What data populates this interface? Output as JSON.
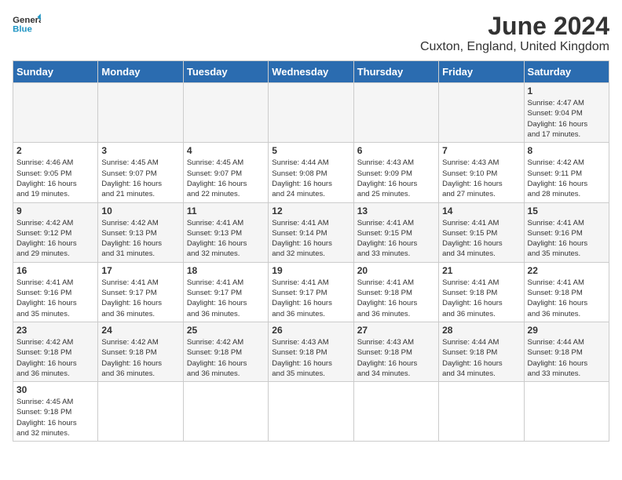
{
  "header": {
    "logo_general": "General",
    "logo_blue": "Blue",
    "title": "June 2024",
    "subtitle": "Cuxton, England, United Kingdom"
  },
  "days_of_week": [
    "Sunday",
    "Monday",
    "Tuesday",
    "Wednesday",
    "Thursday",
    "Friday",
    "Saturday"
  ],
  "weeks": [
    [
      {
        "day": "",
        "info": ""
      },
      {
        "day": "",
        "info": ""
      },
      {
        "day": "",
        "info": ""
      },
      {
        "day": "",
        "info": ""
      },
      {
        "day": "",
        "info": ""
      },
      {
        "day": "",
        "info": ""
      },
      {
        "day": "1",
        "info": "Sunrise: 4:47 AM\nSunset: 9:04 PM\nDaylight: 16 hours\nand 17 minutes."
      }
    ],
    [
      {
        "day": "2",
        "info": "Sunrise: 4:46 AM\nSunset: 9:05 PM\nDaylight: 16 hours\nand 19 minutes."
      },
      {
        "day": "3",
        "info": "Sunrise: 4:45 AM\nSunset: 9:07 PM\nDaylight: 16 hours\nand 21 minutes."
      },
      {
        "day": "4",
        "info": "Sunrise: 4:45 AM\nSunset: 9:07 PM\nDaylight: 16 hours\nand 22 minutes."
      },
      {
        "day": "5",
        "info": "Sunrise: 4:44 AM\nSunset: 9:08 PM\nDaylight: 16 hours\nand 24 minutes."
      },
      {
        "day": "6",
        "info": "Sunrise: 4:43 AM\nSunset: 9:09 PM\nDaylight: 16 hours\nand 25 minutes."
      },
      {
        "day": "7",
        "info": "Sunrise: 4:43 AM\nSunset: 9:10 PM\nDaylight: 16 hours\nand 27 minutes."
      },
      {
        "day": "8",
        "info": "Sunrise: 4:42 AM\nSunset: 9:11 PM\nDaylight: 16 hours\nand 28 minutes."
      }
    ],
    [
      {
        "day": "9",
        "info": "Sunrise: 4:42 AM\nSunset: 9:12 PM\nDaylight: 16 hours\nand 29 minutes."
      },
      {
        "day": "10",
        "info": "Sunrise: 4:42 AM\nSunset: 9:13 PM\nDaylight: 16 hours\nand 31 minutes."
      },
      {
        "day": "11",
        "info": "Sunrise: 4:41 AM\nSunset: 9:13 PM\nDaylight: 16 hours\nand 32 minutes."
      },
      {
        "day": "12",
        "info": "Sunrise: 4:41 AM\nSunset: 9:14 PM\nDaylight: 16 hours\nand 32 minutes."
      },
      {
        "day": "13",
        "info": "Sunrise: 4:41 AM\nSunset: 9:15 PM\nDaylight: 16 hours\nand 33 minutes."
      },
      {
        "day": "14",
        "info": "Sunrise: 4:41 AM\nSunset: 9:15 PM\nDaylight: 16 hours\nand 34 minutes."
      },
      {
        "day": "15",
        "info": "Sunrise: 4:41 AM\nSunset: 9:16 PM\nDaylight: 16 hours\nand 35 minutes."
      }
    ],
    [
      {
        "day": "16",
        "info": "Sunrise: 4:41 AM\nSunset: 9:16 PM\nDaylight: 16 hours\nand 35 minutes."
      },
      {
        "day": "17",
        "info": "Sunrise: 4:41 AM\nSunset: 9:17 PM\nDaylight: 16 hours\nand 36 minutes."
      },
      {
        "day": "18",
        "info": "Sunrise: 4:41 AM\nSunset: 9:17 PM\nDaylight: 16 hours\nand 36 minutes."
      },
      {
        "day": "19",
        "info": "Sunrise: 4:41 AM\nSunset: 9:17 PM\nDaylight: 16 hours\nand 36 minutes."
      },
      {
        "day": "20",
        "info": "Sunrise: 4:41 AM\nSunset: 9:18 PM\nDaylight: 16 hours\nand 36 minutes."
      },
      {
        "day": "21",
        "info": "Sunrise: 4:41 AM\nSunset: 9:18 PM\nDaylight: 16 hours\nand 36 minutes."
      },
      {
        "day": "22",
        "info": "Sunrise: 4:41 AM\nSunset: 9:18 PM\nDaylight: 16 hours\nand 36 minutes."
      }
    ],
    [
      {
        "day": "23",
        "info": "Sunrise: 4:42 AM\nSunset: 9:18 PM\nDaylight: 16 hours\nand 36 minutes."
      },
      {
        "day": "24",
        "info": "Sunrise: 4:42 AM\nSunset: 9:18 PM\nDaylight: 16 hours\nand 36 minutes."
      },
      {
        "day": "25",
        "info": "Sunrise: 4:42 AM\nSunset: 9:18 PM\nDaylight: 16 hours\nand 36 minutes."
      },
      {
        "day": "26",
        "info": "Sunrise: 4:43 AM\nSunset: 9:18 PM\nDaylight: 16 hours\nand 35 minutes."
      },
      {
        "day": "27",
        "info": "Sunrise: 4:43 AM\nSunset: 9:18 PM\nDaylight: 16 hours\nand 34 minutes."
      },
      {
        "day": "28",
        "info": "Sunrise: 4:44 AM\nSunset: 9:18 PM\nDaylight: 16 hours\nand 34 minutes."
      },
      {
        "day": "29",
        "info": "Sunrise: 4:44 AM\nSunset: 9:18 PM\nDaylight: 16 hours\nand 33 minutes."
      }
    ],
    [
      {
        "day": "30",
        "info": "Sunrise: 4:45 AM\nSunset: 9:18 PM\nDaylight: 16 hours\nand 32 minutes."
      },
      {
        "day": "",
        "info": ""
      },
      {
        "day": "",
        "info": ""
      },
      {
        "day": "",
        "info": ""
      },
      {
        "day": "",
        "info": ""
      },
      {
        "day": "",
        "info": ""
      },
      {
        "day": "",
        "info": ""
      }
    ]
  ]
}
